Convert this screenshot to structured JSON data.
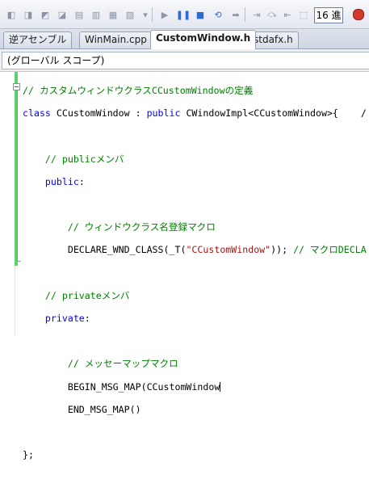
{
  "toolbar": {
    "ime_mode": "16 進"
  },
  "tabs": [
    {
      "label": "逆アセンブル"
    },
    {
      "label": "WinMain.cpp"
    },
    {
      "label": "CustomWindow.h"
    },
    {
      "label": "stdafx.h"
    }
  ],
  "scope": {
    "value": "(グローバル スコープ)"
  },
  "code": {
    "line1_comment": "// カスタムウィンドウクラスCCustomWindowの定義",
    "line2_kw_class": "class",
    "line2_mid": " CCustomWindow : ",
    "line2_kw_public": "public",
    "line2_rest": " CWindowImpl<CCustomWindow>{    /",
    "line4_comment": "// publicメンバ",
    "line5_kw": "public",
    "line5_colon": ":",
    "line7_comment": "// ウィンドウクラス名登録マクロ",
    "line8_pre": "DECLARE_WND_CLASS(_T(",
    "line8_str": "\"CCustomWindow\"",
    "line8_post": ")); ",
    "line8_comment": "// マクロDECLA",
    "line10_comment": "// privateメンバ",
    "line11_kw": "private",
    "line11_colon": ":",
    "line13_comment": "// メッセーマップマクロ",
    "line14_text": "BEGIN_MSG_MAP(CCustomWindow",
    "line15_text": "END_MSG_MAP()",
    "line17_text": "};"
  }
}
